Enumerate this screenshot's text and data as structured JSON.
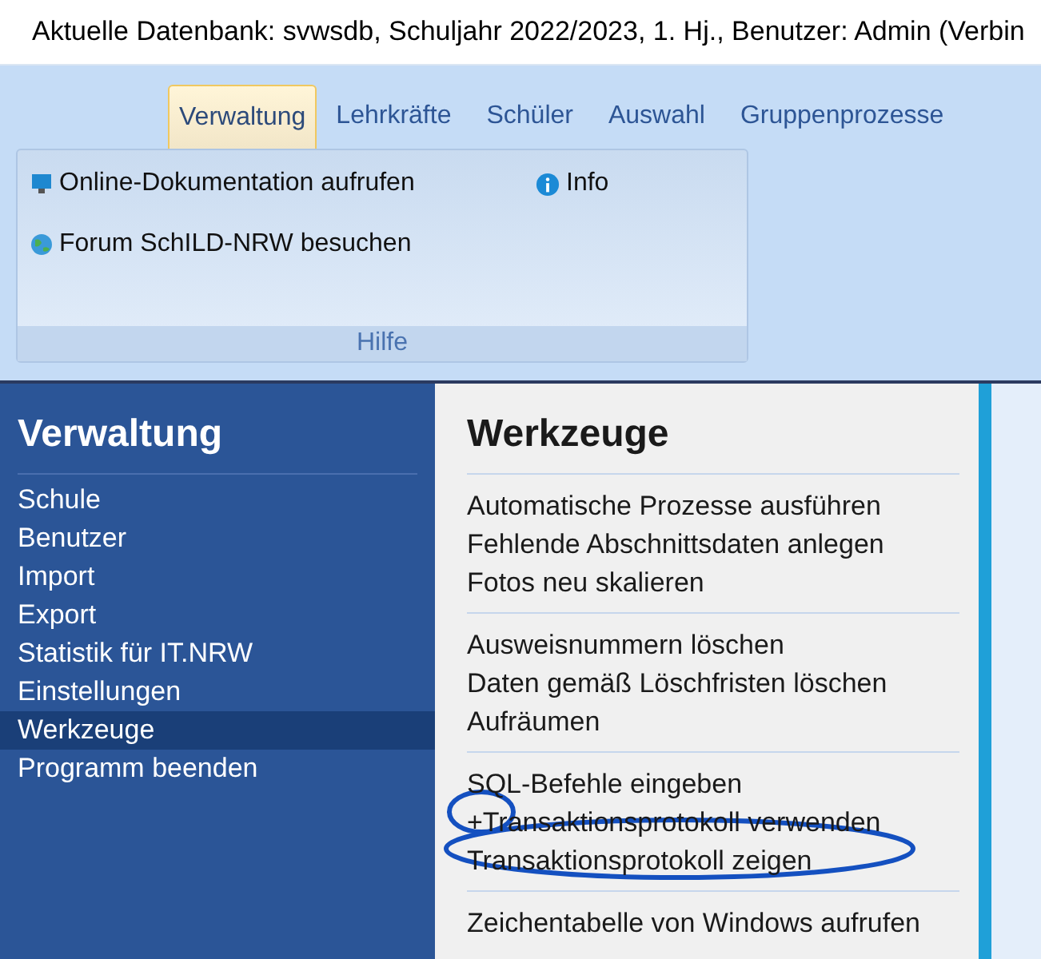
{
  "window": {
    "title": "Aktuelle Datenbank: svwsdb, Schuljahr 2022/2023, 1. Hj., Benutzer: Admin (Verbin"
  },
  "tabs": [
    {
      "label": "Verwaltung",
      "selected": true
    },
    {
      "label": "Lehrkräfte",
      "selected": false
    },
    {
      "label": "Schüler",
      "selected": false
    },
    {
      "label": "Auswahl",
      "selected": false
    },
    {
      "label": "Gruppenprozesse",
      "selected": false
    }
  ],
  "ribbon_group": {
    "label": "Hilfe",
    "items": [
      {
        "label": "Online-Dokumentation aufrufen",
        "kind": "monitor"
      },
      {
        "label": "Info",
        "kind": "info"
      },
      {
        "label": "Forum SchILD-NRW besuchen",
        "kind": "globe"
      }
    ]
  },
  "sidebar": {
    "title": "Verwaltung",
    "items": [
      {
        "label": "Schule",
        "selected": false
      },
      {
        "label": "Benutzer",
        "selected": false
      },
      {
        "label": "Import",
        "selected": false
      },
      {
        "label": "Export",
        "selected": false
      },
      {
        "label": "Statistik für IT.NRW",
        "selected": false
      },
      {
        "label": "Einstellungen",
        "selected": false
      },
      {
        "label": "Werkzeuge",
        "selected": true
      },
      {
        "label": "Programm beenden",
        "selected": false
      }
    ]
  },
  "content": {
    "title": "Werkzeuge",
    "groups": [
      [
        "Automatische Prozesse ausführen",
        "Fehlende Abschnittsdaten anlegen",
        "Fotos neu skalieren"
      ],
      [
        "Ausweisnummern löschen",
        "Daten gemäß Löschfristen löschen",
        "Aufräumen"
      ],
      [
        "SQL-Befehle eingeben",
        "+Transaktionsprotokoll verwenden",
        "Transaktionsprotokoll zeigen"
      ],
      [
        "Zeichentabelle von Windows aufrufen"
      ]
    ]
  }
}
